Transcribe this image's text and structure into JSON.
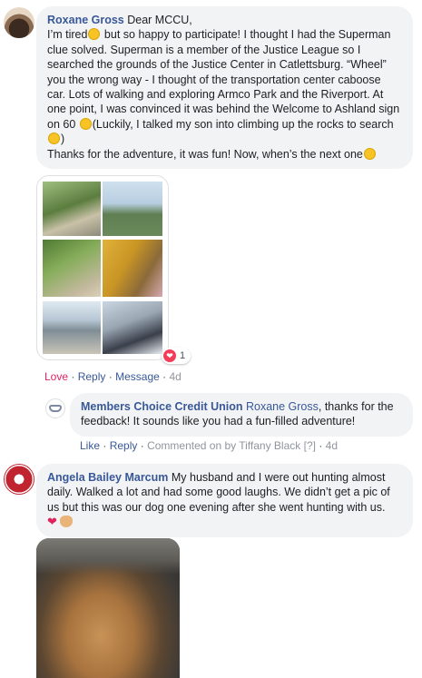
{
  "comments": [
    {
      "author": "Roxane Gross",
      "text_1": " Dear MCCU,",
      "text_2": "I’m tired",
      "text_3": " but so happy to participate! I thought I had the Superman clue solved. Superman is a member of the Justice League so I searched the grounds of the Justice Center in Catlettsburg. “Wheel” you the wrong way - I thought of the transportation center caboose car. Lots of walking and exploring Armco Park and the Riverport. At one point, I was convinced it was behind the Welcome to Ashland sign on 60 ",
      "text_4": "(Luckily, I talked my son into climbing up the rocks to search ",
      "text_5": ")",
      "text_6": "Thanks for the adventure, it was fun! Now, when’s the next one",
      "reaction_count": "1",
      "actions": {
        "love": "Love",
        "reply": "Reply",
        "message": "Message",
        "time": "4d"
      }
    },
    {
      "author": "Angela Bailey Marcum",
      "text_1": " My husband and I were out hunting almost daily. Walked a lot and had some good laughs. We didn’t get a pic of us but this was our dog one evening after she went hunting with us."
    }
  ],
  "reply": {
    "author": "Members Choice Credit Union",
    "mention": "Roxane Gross",
    "text": ", thanks for the feedback! It sounds like you had a fun-filled adventure!",
    "actions": {
      "like": "Like",
      "reply": "Reply",
      "commented_on_by": "Commented on by Tiffany Black",
      "help": "[?]",
      "time": "4d"
    }
  },
  "icons": {
    "reaction": "love-reaction-icon",
    "heart": "red-heart-emoji",
    "dog": "dog-face-emoji"
  },
  "colors": {
    "link": "#385898",
    "love": "#e0245e",
    "bubble": "#f2f3f5"
  }
}
